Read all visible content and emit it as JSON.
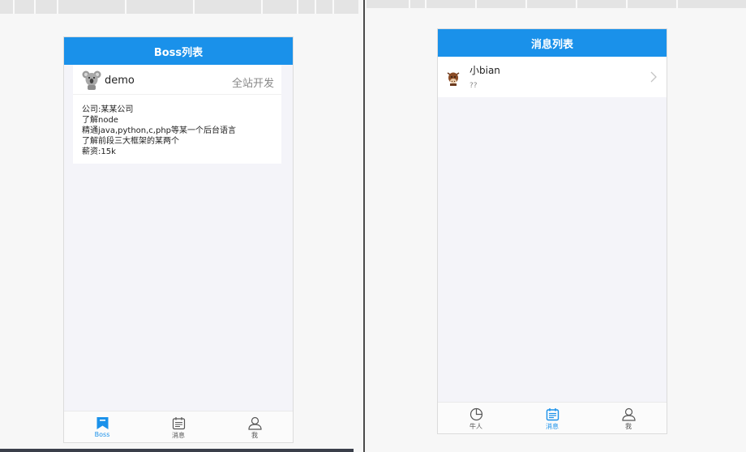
{
  "left_phone": {
    "navbar_title": "Boss列表",
    "card": {
      "avatar_icon": "koala-avatar-icon",
      "name": "demo",
      "extra": "全站开发",
      "lines": [
        "公司:某某公司",
        "了解node",
        "精通java,python,c,php等某一个后台语言",
        "了解前段三大框架的某两个",
        "薪资:15k"
      ]
    },
    "tabs": [
      {
        "label": "Boss",
        "icon": "bookmark-icon",
        "active": true
      },
      {
        "label": "消息",
        "icon": "calendar-icon",
        "active": false
      },
      {
        "label": "我",
        "icon": "user-icon",
        "active": false
      }
    ]
  },
  "right_phone": {
    "navbar_title": "消息列表",
    "messages": [
      {
        "name": "小bian",
        "preview": "??",
        "avatar_icon": "cow-avatar-icon"
      }
    ],
    "tabs": [
      {
        "label": "牛人",
        "icon": "pie-chart-icon",
        "active": false
      },
      {
        "label": "消息",
        "icon": "calendar-icon",
        "active": true
      },
      {
        "label": "我",
        "icon": "user-icon",
        "active": false
      }
    ]
  },
  "colors": {
    "primary": "#1a91ea",
    "page_bg": "#f4f4f9",
    "tab_inactive": "#555555"
  }
}
